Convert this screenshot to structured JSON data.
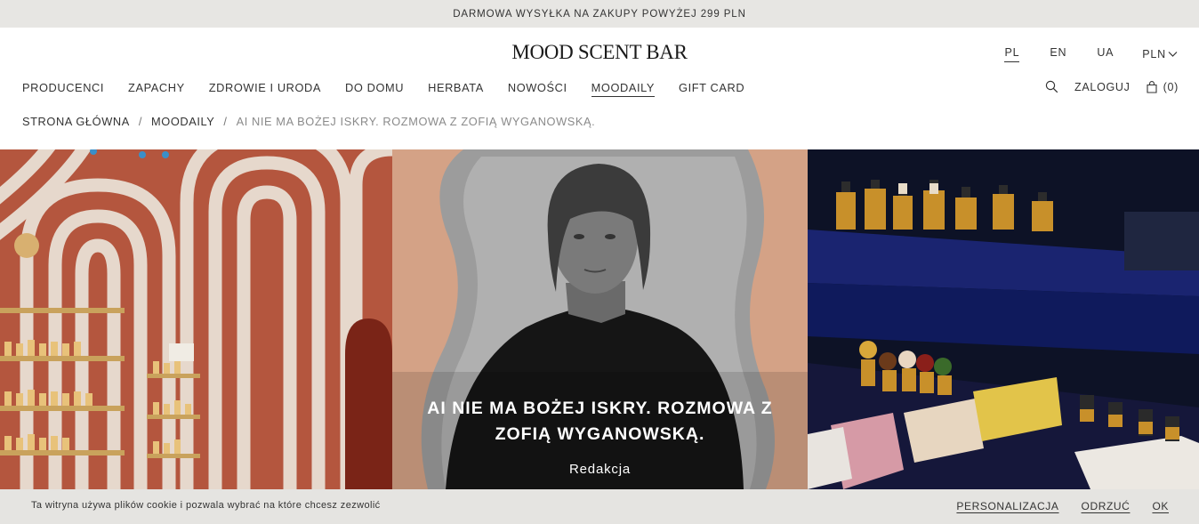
{
  "promo": {
    "text": "DARMOWA WYSYŁKA NA ZAKUPY POWYŻEJ 299 PLN"
  },
  "header": {
    "logo": "MOOD SCENT BAR",
    "languages": [
      "PL",
      "EN",
      "UA"
    ],
    "active_language": "PL",
    "currency": "PLN"
  },
  "nav": {
    "items": [
      "PRODUCENCI",
      "ZAPACHY",
      "ZDROWIE I URODA",
      "DO DOMU",
      "HERBATA",
      "NOWOŚCI",
      "MOODAILY",
      "GIFT CARD"
    ],
    "active": "MOODAILY",
    "login": "ZALOGUJ",
    "cart_count": "(0)"
  },
  "breadcrumb": {
    "home": "STRONA GŁÓWNA",
    "section": "MOODAILY",
    "current": "AI NIE MA BOŻEJ ISKRY. ROZMOWA Z ZOFIĄ WYGANOWSKĄ.",
    "separator": "/"
  },
  "hero": {
    "title_line1": "AI NIE MA BOŻEJ ISKRY. ROZMOWA Z",
    "title_line2": "ZOFIĄ WYGANOWSKĄ.",
    "author": "Redakcja"
  },
  "cookie": {
    "text": "Ta witryna używa plików cookie i pozwala wybrać na które chcesz zezwolić",
    "personalize": "PERSONALIZACJA",
    "reject": "ODRZUĆ",
    "accept": "OK"
  },
  "colors": {
    "promo_bg": "#e7e6e3",
    "cookie_bg": "#e5e4e1",
    "text": "#333333",
    "breadcrumb_current": "#8a8a8a"
  }
}
